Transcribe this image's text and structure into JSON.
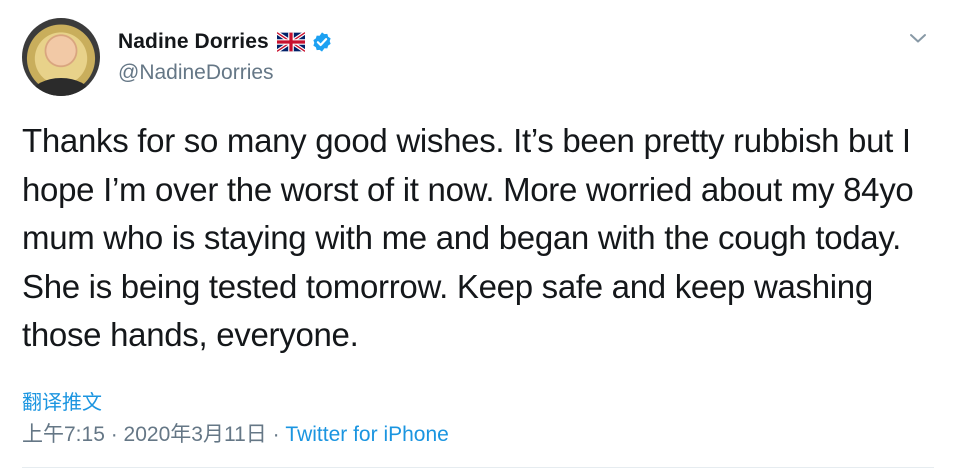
{
  "author": {
    "name": "Nadine Dorries",
    "handle": "@NadineDorries",
    "flag_icon": "uk-flag-icon",
    "verified_icon": "verified-badge-icon"
  },
  "tweet": {
    "text": "Thanks for so many good wishes. It’s been pretty rubbish but I hope I’m over the worst of it now. More worried about my 84yo mum who is staying with me and began with the cough today. She is being tested tomorrow. Keep safe and keep washing those hands, everyone."
  },
  "translate_label": "翻译推文",
  "meta": {
    "time": "上午7:15",
    "separator1": " · ",
    "date": "2020年3月11日",
    "separator2": " · ",
    "source": "Twitter for iPhone"
  },
  "colors": {
    "link": "#1b95e0",
    "secondary": "#657786",
    "text": "#14171a",
    "verified": "#1da1f2"
  }
}
